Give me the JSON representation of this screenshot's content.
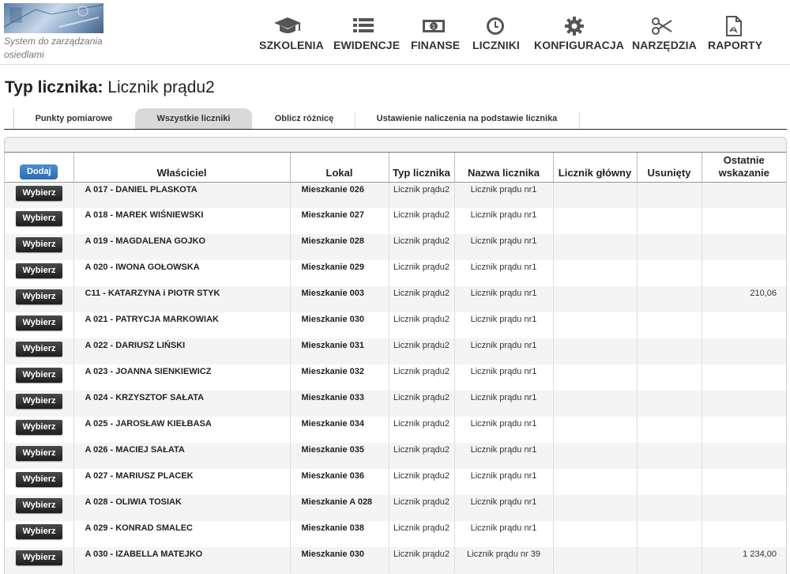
{
  "logo": {
    "text": "System do zarządzania osiedlami"
  },
  "nav": [
    {
      "label": "SZKOLENIA",
      "icon": "graduation-cap-icon"
    },
    {
      "label": "EWIDENCJE",
      "icon": "list-icon"
    },
    {
      "label": "FINANSE",
      "icon": "money-icon"
    },
    {
      "label": "LICZNIKI",
      "icon": "clock-icon"
    },
    {
      "label": "KONFIGURACJA",
      "icon": "gear-icon"
    },
    {
      "label": "NARZĘDZIA",
      "icon": "scissors-icon"
    },
    {
      "label": "RAPORTY",
      "icon": "pdf-document-icon"
    }
  ],
  "page": {
    "title_prefix": "Typ licznika:",
    "title_value": "Licznik prądu2"
  },
  "tabs": [
    {
      "label": "Punkty pomiarowe",
      "active": false
    },
    {
      "label": "Wszystkie liczniki",
      "active": true
    },
    {
      "label": "Oblicz różnicę",
      "active": false
    },
    {
      "label": "Ustawienie naliczenia na podstawie licznika",
      "active": false
    }
  ],
  "table": {
    "add_label": "Dodaj",
    "select_label": "Wybierz",
    "headers": {
      "owner": "Właściciel",
      "lokal": "Lokal",
      "typ": "Typ licznika",
      "nazwa": "Nazwa licznika",
      "glowny": "Licznik główny",
      "usuniety": "Usunięty",
      "ostatnie": "Ostatnie wskazanie"
    },
    "rows": [
      {
        "owner": "A 017 - DANIEL PLASKOTA",
        "lokal": "Mieszkanie 026",
        "typ": "Licznik prądu2",
        "nazwa": "Licznik prądu nr1",
        "glowny": "",
        "usuniety": "",
        "ostatnie": ""
      },
      {
        "owner": "A 018 - MAREK WIŚNIEWSKI",
        "lokal": "Mieszkanie 027",
        "typ": "Licznik prądu2",
        "nazwa": "Licznik prądu nr1",
        "glowny": "",
        "usuniety": "",
        "ostatnie": ""
      },
      {
        "owner": "A 019 - MAGDALENA GOJKO",
        "lokal": "Mieszkanie 028",
        "typ": "Licznik prądu2",
        "nazwa": "Licznik prądu nr1",
        "glowny": "",
        "usuniety": "",
        "ostatnie": ""
      },
      {
        "owner": "A 020 - IWONA GOŁOWSKA",
        "lokal": "Mieszkanie 029",
        "typ": "Licznik prądu2",
        "nazwa": "Licznik prądu nr1",
        "glowny": "",
        "usuniety": "",
        "ostatnie": ""
      },
      {
        "owner": "C11 - KATARZYNA i PIOTR STYK",
        "lokal": "Mieszkanie 003",
        "typ": "Licznik prądu2",
        "nazwa": "Licznik prądu nr1",
        "glowny": "",
        "usuniety": "",
        "ostatnie": "210,06"
      },
      {
        "owner": "A 021 - PATRYCJA MARKOWIAK",
        "lokal": "Mieszkanie 030",
        "typ": "Licznik prądu2",
        "nazwa": "Licznik prądu nr1",
        "glowny": "",
        "usuniety": "",
        "ostatnie": ""
      },
      {
        "owner": "A 022 - DARIUSZ LIŃSKI",
        "lokal": "Mieszkanie 031",
        "typ": "Licznik prądu2",
        "nazwa": "Licznik prądu nr1",
        "glowny": "",
        "usuniety": "",
        "ostatnie": ""
      },
      {
        "owner": "A 023 - JOANNA SIENKIEWICZ",
        "lokal": "Mieszkanie 032",
        "typ": "Licznik prądu2",
        "nazwa": "Licznik prądu nr1",
        "glowny": "",
        "usuniety": "",
        "ostatnie": ""
      },
      {
        "owner": "A 024 - KRZYSZTOF SAŁATA",
        "lokal": "Mieszkanie 033",
        "typ": "Licznik prądu2",
        "nazwa": "Licznik prądu nr1",
        "glowny": "",
        "usuniety": "",
        "ostatnie": ""
      },
      {
        "owner": "A 025 - JAROSŁAW KIEŁBASA",
        "lokal": "Mieszkanie 034",
        "typ": "Licznik prądu2",
        "nazwa": "Licznik prądu nr1",
        "glowny": "",
        "usuniety": "",
        "ostatnie": ""
      },
      {
        "owner": "A 026 - MACIEJ SAŁATA",
        "lokal": "Mieszkanie 035",
        "typ": "Licznik prądu2",
        "nazwa": "Licznik prądu nr1",
        "glowny": "",
        "usuniety": "",
        "ostatnie": ""
      },
      {
        "owner": "A 027 - MARIUSZ PLACEK",
        "lokal": "Mieszkanie 036",
        "typ": "Licznik prądu2",
        "nazwa": "Licznik prądu nr1",
        "glowny": "",
        "usuniety": "",
        "ostatnie": ""
      },
      {
        "owner": "A 028 - OLIWIA TOSIAK",
        "lokal": "Mieszkanie A 028",
        "typ": "Licznik prądu2",
        "nazwa": "Licznik prądu nr1",
        "glowny": "",
        "usuniety": "",
        "ostatnie": ""
      },
      {
        "owner": "A 029 - KONRAD SMALEC",
        "lokal": "Mieszkanie 038",
        "typ": "Licznik prądu2",
        "nazwa": "Licznik prądu nr1",
        "glowny": "",
        "usuniety": "",
        "ostatnie": ""
      },
      {
        "owner": "A 030 - IZABELLA MATEJKO",
        "lokal": "Mieszkanie 030",
        "typ": "Licznik prądu2",
        "nazwa": "Licznik prądu nr 39",
        "glowny": "",
        "usuniety": "",
        "ostatnie": "1 234,00"
      }
    ]
  },
  "colors": {
    "add_button": "#3779c3",
    "select_button": "#2a2a2a",
    "active_tab": "#d9d9d9"
  }
}
